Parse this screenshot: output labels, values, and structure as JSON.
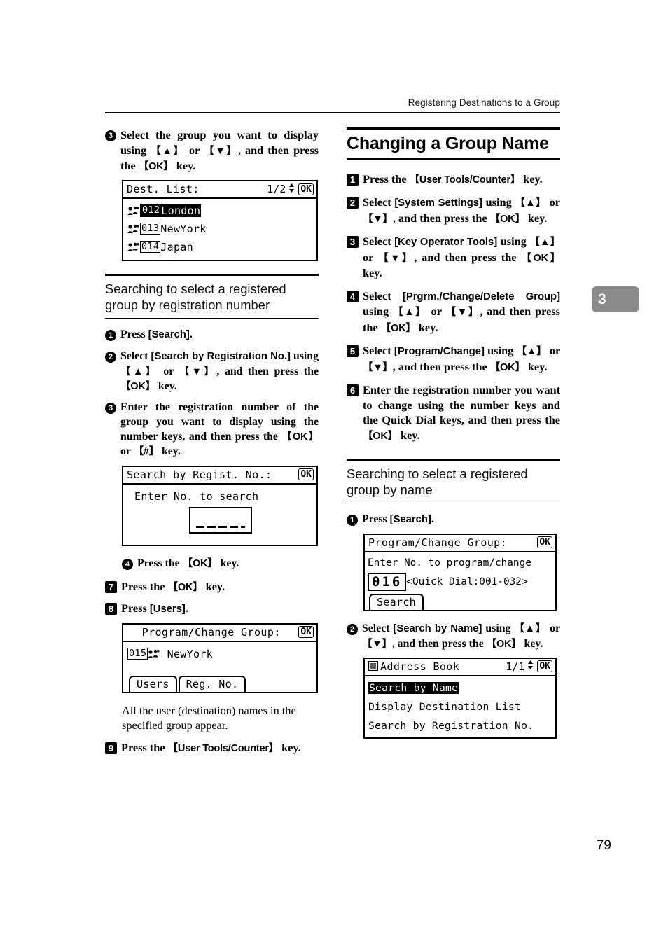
{
  "header": {
    "running_head": "Registering Destinations to a Group",
    "chapter_tab": "3",
    "page_number": "79"
  },
  "left_column": {
    "step3": {
      "num": "3",
      "text_1": "Select the group you want to display using ",
      "key_up": "【▲】",
      "text_2": " or ",
      "key_down": "【▼】",
      "text_3": ", and then press the ",
      "key_ok": "【OK】",
      "text_4": " key."
    },
    "lcd_dest_list": {
      "title": "Dest. List:",
      "page_indicator": "1/2",
      "ok_label": "OK",
      "rows": [
        {
          "reg": "012",
          "name": "London",
          "selected": true
        },
        {
          "reg": "013",
          "name": "NewYork",
          "selected": false
        },
        {
          "reg": "014",
          "name": "Japan",
          "selected": false
        }
      ]
    },
    "subsection": {
      "heading": "Searching to select a registered group by registration number",
      "steps": [
        {
          "num": "1",
          "text_1": "Press ",
          "ui_1": "[Search]",
          "text_2": "."
        },
        {
          "num": "2",
          "text_1": "Select ",
          "ui_1": "[Search by Registration No.]",
          "text_2": " using ",
          "key_up": "【▲】",
          "text_3": " or ",
          "key_down": "【▼】",
          "text_4": ", and then press the ",
          "key_ok": "【OK】",
          "text_5": " key."
        },
        {
          "num": "3",
          "text_1": "Enter the registration number of the group you want to display using the number keys, and then press the ",
          "key_ok": "【OK】",
          "text_2": " or ",
          "key_hash": "【#】",
          "text_3": " key."
        }
      ],
      "lcd_search_regist": {
        "title": "Search by Regist. No.:",
        "ok_label": "OK",
        "prompt": "Enter No. to search"
      },
      "step4": {
        "num": "4",
        "text_1": "Press the ",
        "key_ok": "【OK】",
        "text_2": " key."
      }
    },
    "step7": {
      "num": "7",
      "text_1": "Press the ",
      "key_ok": "【OK】",
      "text_2": " key."
    },
    "step8": {
      "num": "8",
      "text_1": "Press ",
      "ui_1": "[Users]",
      "text_2": "."
    },
    "lcd_program_change_group": {
      "title": "Program/Change Group:",
      "ok_label": "OK",
      "reg": "015",
      "name": "NewYork",
      "tabs": [
        "Users",
        "Reg. No."
      ]
    },
    "note": "All the user (destination) names in the specified group appear.",
    "step9": {
      "num": "9",
      "text_1": "Press the ",
      "key_utc": "【User Tools/Counter】",
      "text_2": " key."
    }
  },
  "right_column": {
    "section_title": "Changing a Group Name",
    "steps": [
      {
        "num": "1",
        "text_1": "Press the ",
        "key_utc": "【User Tools/Counter】",
        "text_2": " key."
      },
      {
        "num": "2",
        "text_1": "Select ",
        "ui_1": "[System Settings]",
        "text_2": " using ",
        "key_up": "【▲】",
        "text_3": " or ",
        "key_down": "【▼】",
        "text_4": ", and then press the ",
        "key_ok": "【OK】",
        "text_5": " key."
      },
      {
        "num": "3",
        "text_1": "Select ",
        "ui_1": "[Key Operator Tools]",
        "text_2": " using ",
        "key_up": "【▲】",
        "text_3": " or ",
        "key_down": "【▼】",
        "text_4": ", and then press the ",
        "key_ok": "【OK】",
        "text_5": " key."
      },
      {
        "num": "4",
        "text_1": "Select ",
        "ui_1": "[Prgrm./Change/Delete Group]",
        "text_2": " using ",
        "key_up": "【▲】",
        "text_3": " or ",
        "key_down": "【▼】",
        "text_4": ", and then press the ",
        "key_ok": "【OK】",
        "text_5": " key."
      },
      {
        "num": "5",
        "text_1": " Select ",
        "ui_1": "[Program/Change]",
        "text_2": " using ",
        "key_up": "【▲】",
        "text_3": " or ",
        "key_down": "【▼】",
        "text_4": ", and then press the ",
        "key_ok": "【OK】",
        "text_5": " key."
      },
      {
        "num": "6",
        "text_1": "Enter the registration number you want to change using the number keys and the Quick Dial keys, and then press the ",
        "key_ok": "【OK】",
        "text_2": " key."
      }
    ],
    "subsection": {
      "heading": "Searching to select a registered group by name",
      "step1": {
        "num": "1",
        "text_1": "Press ",
        "ui_1": "[Search]",
        "text_2": "."
      },
      "lcd_program_change_group": {
        "title": "Program/Change Group:",
        "ok_label": "OK",
        "prompt": "Enter No. to program/change",
        "number": "016",
        "hint": "<Quick Dial:001-032>",
        "tab": "Search"
      },
      "step2": {
        "num": "2",
        "text_1": "Select ",
        "ui_1": "[Search by Name]",
        "text_2": " using ",
        "key_up": "【▲】",
        "text_3": " or ",
        "key_down": "【▼】",
        "text_4": ", and then press the ",
        "key_ok": "【OK】",
        "text_5": " key."
      },
      "lcd_address_book": {
        "title": "Address Book",
        "page_indicator": "1/1",
        "ok_label": "OK",
        "rows": [
          {
            "label": "Search by Name",
            "selected": true
          },
          {
            "label": "Display Destination List",
            "selected": false
          },
          {
            "label": "Search by Registration No.",
            "selected": false
          }
        ]
      }
    }
  },
  "colors": {
    "ink": "#000000",
    "chapter_tab_bg": "#8b8b8b",
    "chapter_tab_text": "#ffffff"
  }
}
